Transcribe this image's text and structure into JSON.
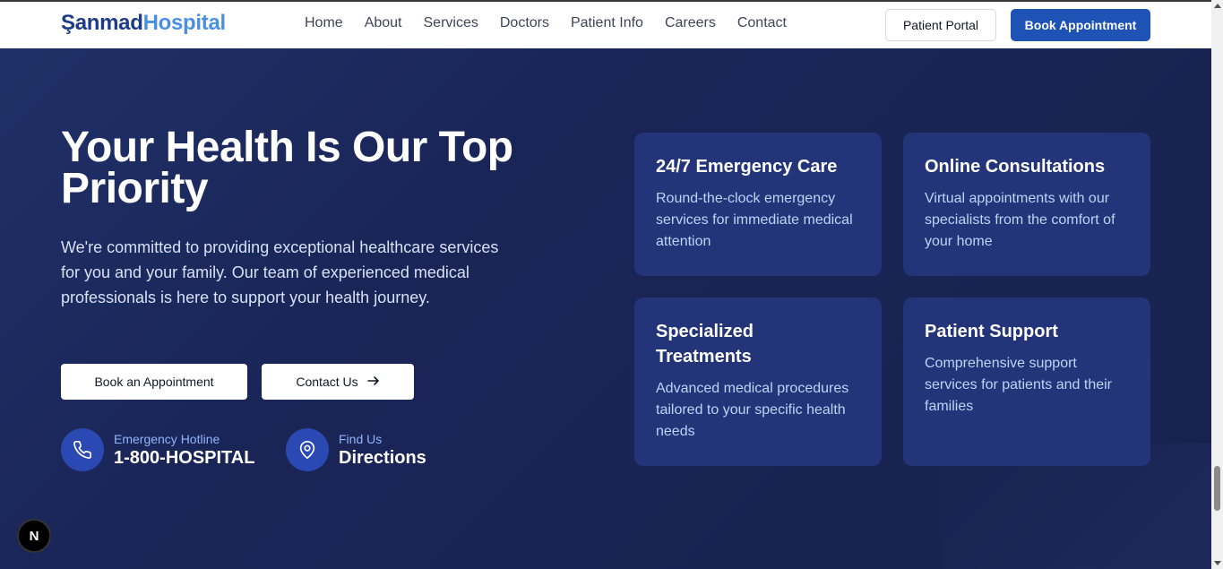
{
  "header": {
    "logo_part1": "Şanmad",
    "logo_part2": "Hospital",
    "nav": [
      "Home",
      "About",
      "Services",
      "Doctors",
      "Patient Info",
      "Careers",
      "Contact"
    ],
    "patient_portal": "Patient Portal",
    "book_appointment": "Book Appointment"
  },
  "hero": {
    "title": "Your Health Is Our Top Priority",
    "description": "We're committed to providing exceptional healthcare services for you and your family. Our team of experienced medical professionals is here to support your health journey.",
    "primary_button": "Book an Appointment",
    "secondary_button": "Contact Us",
    "secondary_arrow": "→",
    "hotline_label": "Emergency Hotline",
    "hotline_value": "1-800-HOSPITAL",
    "find_label": "Find Us",
    "find_value": "Directions"
  },
  "cards": [
    {
      "title": "24/7 Emergency Care",
      "text": "Round-the-clock emergency services for immediate medical attention"
    },
    {
      "title": "Online Consultations",
      "text": "Virtual appointments with our specialists from the comfort of your home"
    },
    {
      "title": "Specialized Treatments",
      "text": "Advanced medical procedures tailored to your specific health needs"
    },
    {
      "title": "Patient Support",
      "text": "Comprehensive support services for patients and their families"
    }
  ],
  "badge": "N",
  "colors": {
    "brand_dark": "#1e3a8a",
    "brand_light": "#4a90e2",
    "accent_button": "#1e52b5",
    "hero_bg": "#1a2557",
    "card_bg": "#233479",
    "icon_circle": "#2b49b2"
  },
  "icons": [
    "phone-icon",
    "map-pin-icon",
    "arrow-right-icon"
  ]
}
